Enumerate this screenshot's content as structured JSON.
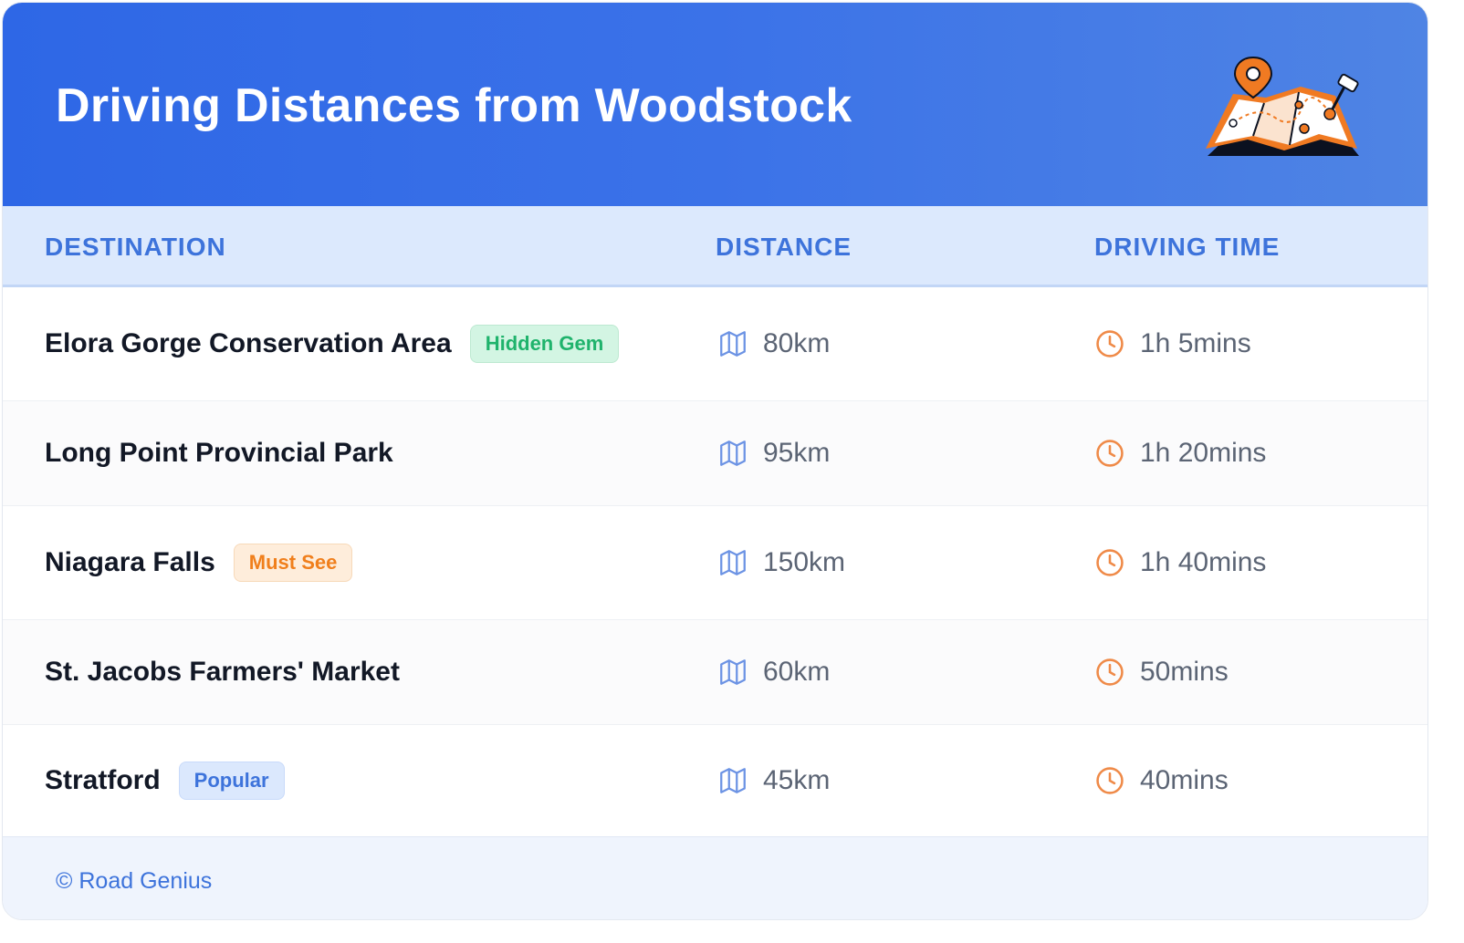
{
  "header": {
    "title": "Driving Distances from Woodstock",
    "illustration_icon": "folded-map-with-location-pin-icon"
  },
  "columns": {
    "destination": "DESTINATION",
    "distance": "DISTANCE",
    "driving_time": "DRIVING TIME"
  },
  "rows": [
    {
      "destination": "Elora Gorge Conservation Area",
      "badge": "Hidden Gem",
      "badge_color": "#1fb36c",
      "distance": "80km",
      "time": "1h 5mins"
    },
    {
      "destination": "Long Point Provincial Park",
      "badge": "",
      "distance": "95km",
      "time": "1h 20mins"
    },
    {
      "destination": "Niagara Falls",
      "badge": "Must See",
      "badge_color": "#f07f1c",
      "distance": "150km",
      "time": "1h 40mins"
    },
    {
      "destination": "St. Jacobs Farmers' Market",
      "badge": "",
      "distance": "60km",
      "time": "50mins"
    },
    {
      "destination": "Stratford",
      "badge": "Popular",
      "badge_color": "#3d73db",
      "distance": "45km",
      "time": "40mins"
    }
  ],
  "icons": {
    "distance": "map-icon",
    "time": "clock-icon"
  },
  "footer": {
    "text": "© Road Genius"
  },
  "colors": {
    "header_start": "#2e67e6",
    "header_end": "#4f84e4",
    "accent_blue": "#3d73db",
    "accent_orange": "#f07f1c"
  }
}
